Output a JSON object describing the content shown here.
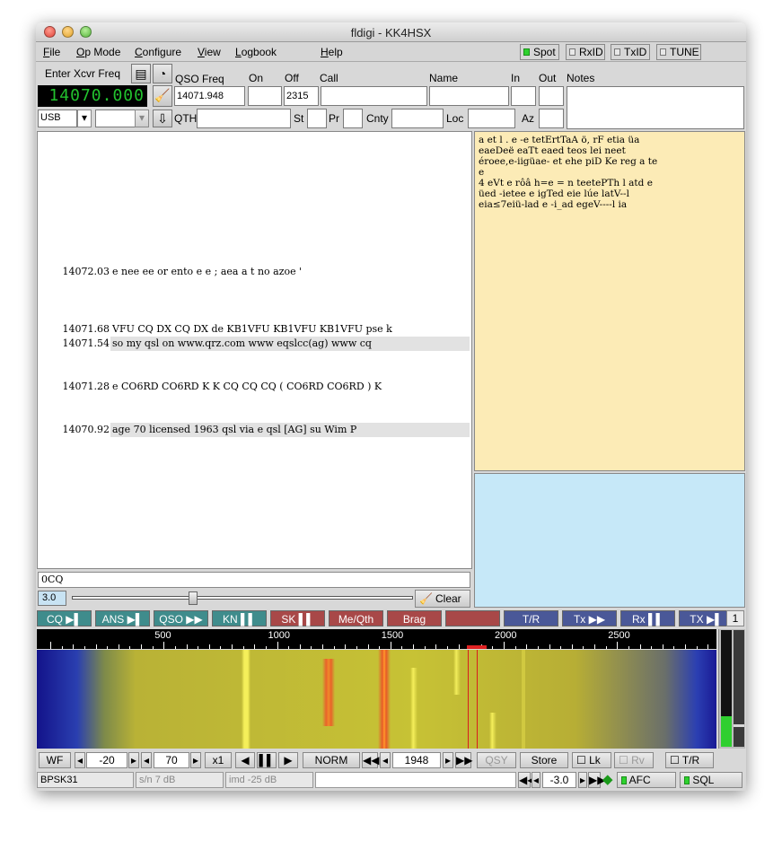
{
  "window": {
    "title": "fldigi - KK4HSX"
  },
  "menubar": {
    "items": [
      "File",
      "Op Mode",
      "Configure",
      "View",
      "Logbook",
      "Help"
    ],
    "checks": [
      {
        "label": "Spot",
        "on": true
      },
      {
        "label": "RxID",
        "on": false
      },
      {
        "label": "TxID",
        "on": false
      },
      {
        "label": "TUNE",
        "on": false
      }
    ]
  },
  "rig": {
    "enter_label": "Enter Xcvr Freq",
    "freq": "14070.000",
    "mode": "USB",
    "bandwidth": ""
  },
  "log": {
    "labels": {
      "qso_freq": "QSO Freq",
      "on": "On",
      "off": "Off",
      "call": "Call",
      "name": "Name",
      "in": "In",
      "out": "Out",
      "notes": "Notes",
      "qth": "QTH",
      "st": "St",
      "pr": "Pr",
      "cnty": "Cnty",
      "loc": "Loc",
      "az": "Az"
    },
    "qso_freq": "14071.948",
    "on": "",
    "off": "2315",
    "call": "",
    "name": "",
    "in": "",
    "out": "",
    "qth": "",
    "st": "",
    "pr": "",
    "cnty": "",
    "loc": "",
    "az": "",
    "notes": ""
  },
  "browser": {
    "rows": [
      {
        "freq": "",
        "text": ""
      },
      {
        "freq": "",
        "text": ""
      },
      {
        "freq": "",
        "text": ""
      },
      {
        "freq": "",
        "text": ""
      },
      {
        "freq": "",
        "text": ""
      },
      {
        "freq": "",
        "text": ""
      },
      {
        "freq": "",
        "text": ""
      },
      {
        "freq": "",
        "text": ""
      },
      {
        "freq": "",
        "text": ""
      },
      {
        "freq": "14072.03",
        "text": "e  nee ee   or ento     e e ; aea   a t no    azoe '"
      },
      {
        "freq": "",
        "text": ""
      },
      {
        "freq": "",
        "text": ""
      },
      {
        "freq": "",
        "text": ""
      },
      {
        "freq": "14071.68",
        "text": "VFU  CQ DX CQ DX de KB1VFU KB1VFU KB1VFU pse k"
      },
      {
        "freq": "14071.54",
        "text": "so my qsl on  www.qrz.com  www eqslcc(ag) www cq"
      },
      {
        "freq": "",
        "text": ""
      },
      {
        "freq": "",
        "text": ""
      },
      {
        "freq": "14071.28",
        "text": "e CO6RD CO6RD K K  CQ  CQ  CQ ( CO6RD  CO6RD ) K"
      },
      {
        "freq": "",
        "text": ""
      },
      {
        "freq": "",
        "text": ""
      },
      {
        "freq": "14070.92",
        "text": "age 70 licensed 1963 qsl via e qsl [AG] su Wim P"
      },
      {
        "freq": "",
        "text": ""
      },
      {
        "freq": "",
        "text": ""
      },
      {
        "freq": "",
        "text": ""
      },
      {
        "freq": "",
        "text": ""
      },
      {
        "freq": "",
        "text": ""
      },
      {
        "freq": "",
        "text": ""
      },
      {
        "freq": "",
        "text": ""
      },
      {
        "freq": "",
        "text": ""
      },
      {
        "freq": "",
        "text": ""
      }
    ],
    "query": "0CQ",
    "squelch": "3.0",
    "squelch_level": 0.35,
    "clear_label": "Clear"
  },
  "rx_text": {
    "lines": [
      " a et  l    . e -e tetErtTaA ö, rF etia üa",
      "eaeDeë eaTt eaed teos lei neet",
      "éroee,e-iigüae- et ehe   piD  Ke reg a te",
      "e",
      "4 eVt  e rôâ  h=e = n  teetePTh l atd e",
      "üed -ietee e igTed eie lúe latV--l",
      "eia≤7eiü-lad e -i_ad egeV----l ia"
    ]
  },
  "macros": [
    {
      "label": "CQ ▶▌",
      "color": "teal"
    },
    {
      "label": "ANS ▶▌",
      "color": "teal"
    },
    {
      "label": "QSO ▶▶",
      "color": "teal"
    },
    {
      "label": "KN ▌▌",
      "color": "teal"
    },
    {
      "label": "SK ▌▌",
      "color": "red"
    },
    {
      "label": "Me/Qth",
      "color": "red"
    },
    {
      "label": "Brag",
      "color": "red"
    },
    {
      "label": "",
      "color": "red"
    },
    {
      "label": "T/R",
      "color": "blue"
    },
    {
      "label": "Tx ▶▶",
      "color": "blue"
    },
    {
      "label": "Rx ▌▌",
      "color": "blue"
    },
    {
      "label": "TX ▶▌",
      "color": "blue"
    }
  ],
  "macro_set": "1",
  "scale": {
    "labels": [
      "500",
      "1000",
      "1500",
      "2000",
      "2500"
    ]
  },
  "waterfall": {
    "cursor_freq": "1948"
  },
  "controls": {
    "wf": "WF",
    "ref": "-20",
    "range": "70",
    "zoom": "x1",
    "norm": "NORM",
    "freq": "1948",
    "qsy": "QSY",
    "store": "Store",
    "lk": "Lk",
    "rv": "Rv",
    "tr": "T/R"
  },
  "status": {
    "mode": "BPSK31",
    "sn": "s/n  7 dB",
    "imd": "imd -25 dB",
    "msg": "",
    "afc_val": "-3.0",
    "afc": "AFC",
    "sql": "SQL"
  },
  "colors": {
    "freq_display": "#22c22e",
    "rx_pane": "#fcebb6",
    "tx_pane": "#c6e8f8",
    "macro_teal": "#3f8c8c",
    "macro_red": "#a84848",
    "macro_blue": "#4a5898"
  }
}
